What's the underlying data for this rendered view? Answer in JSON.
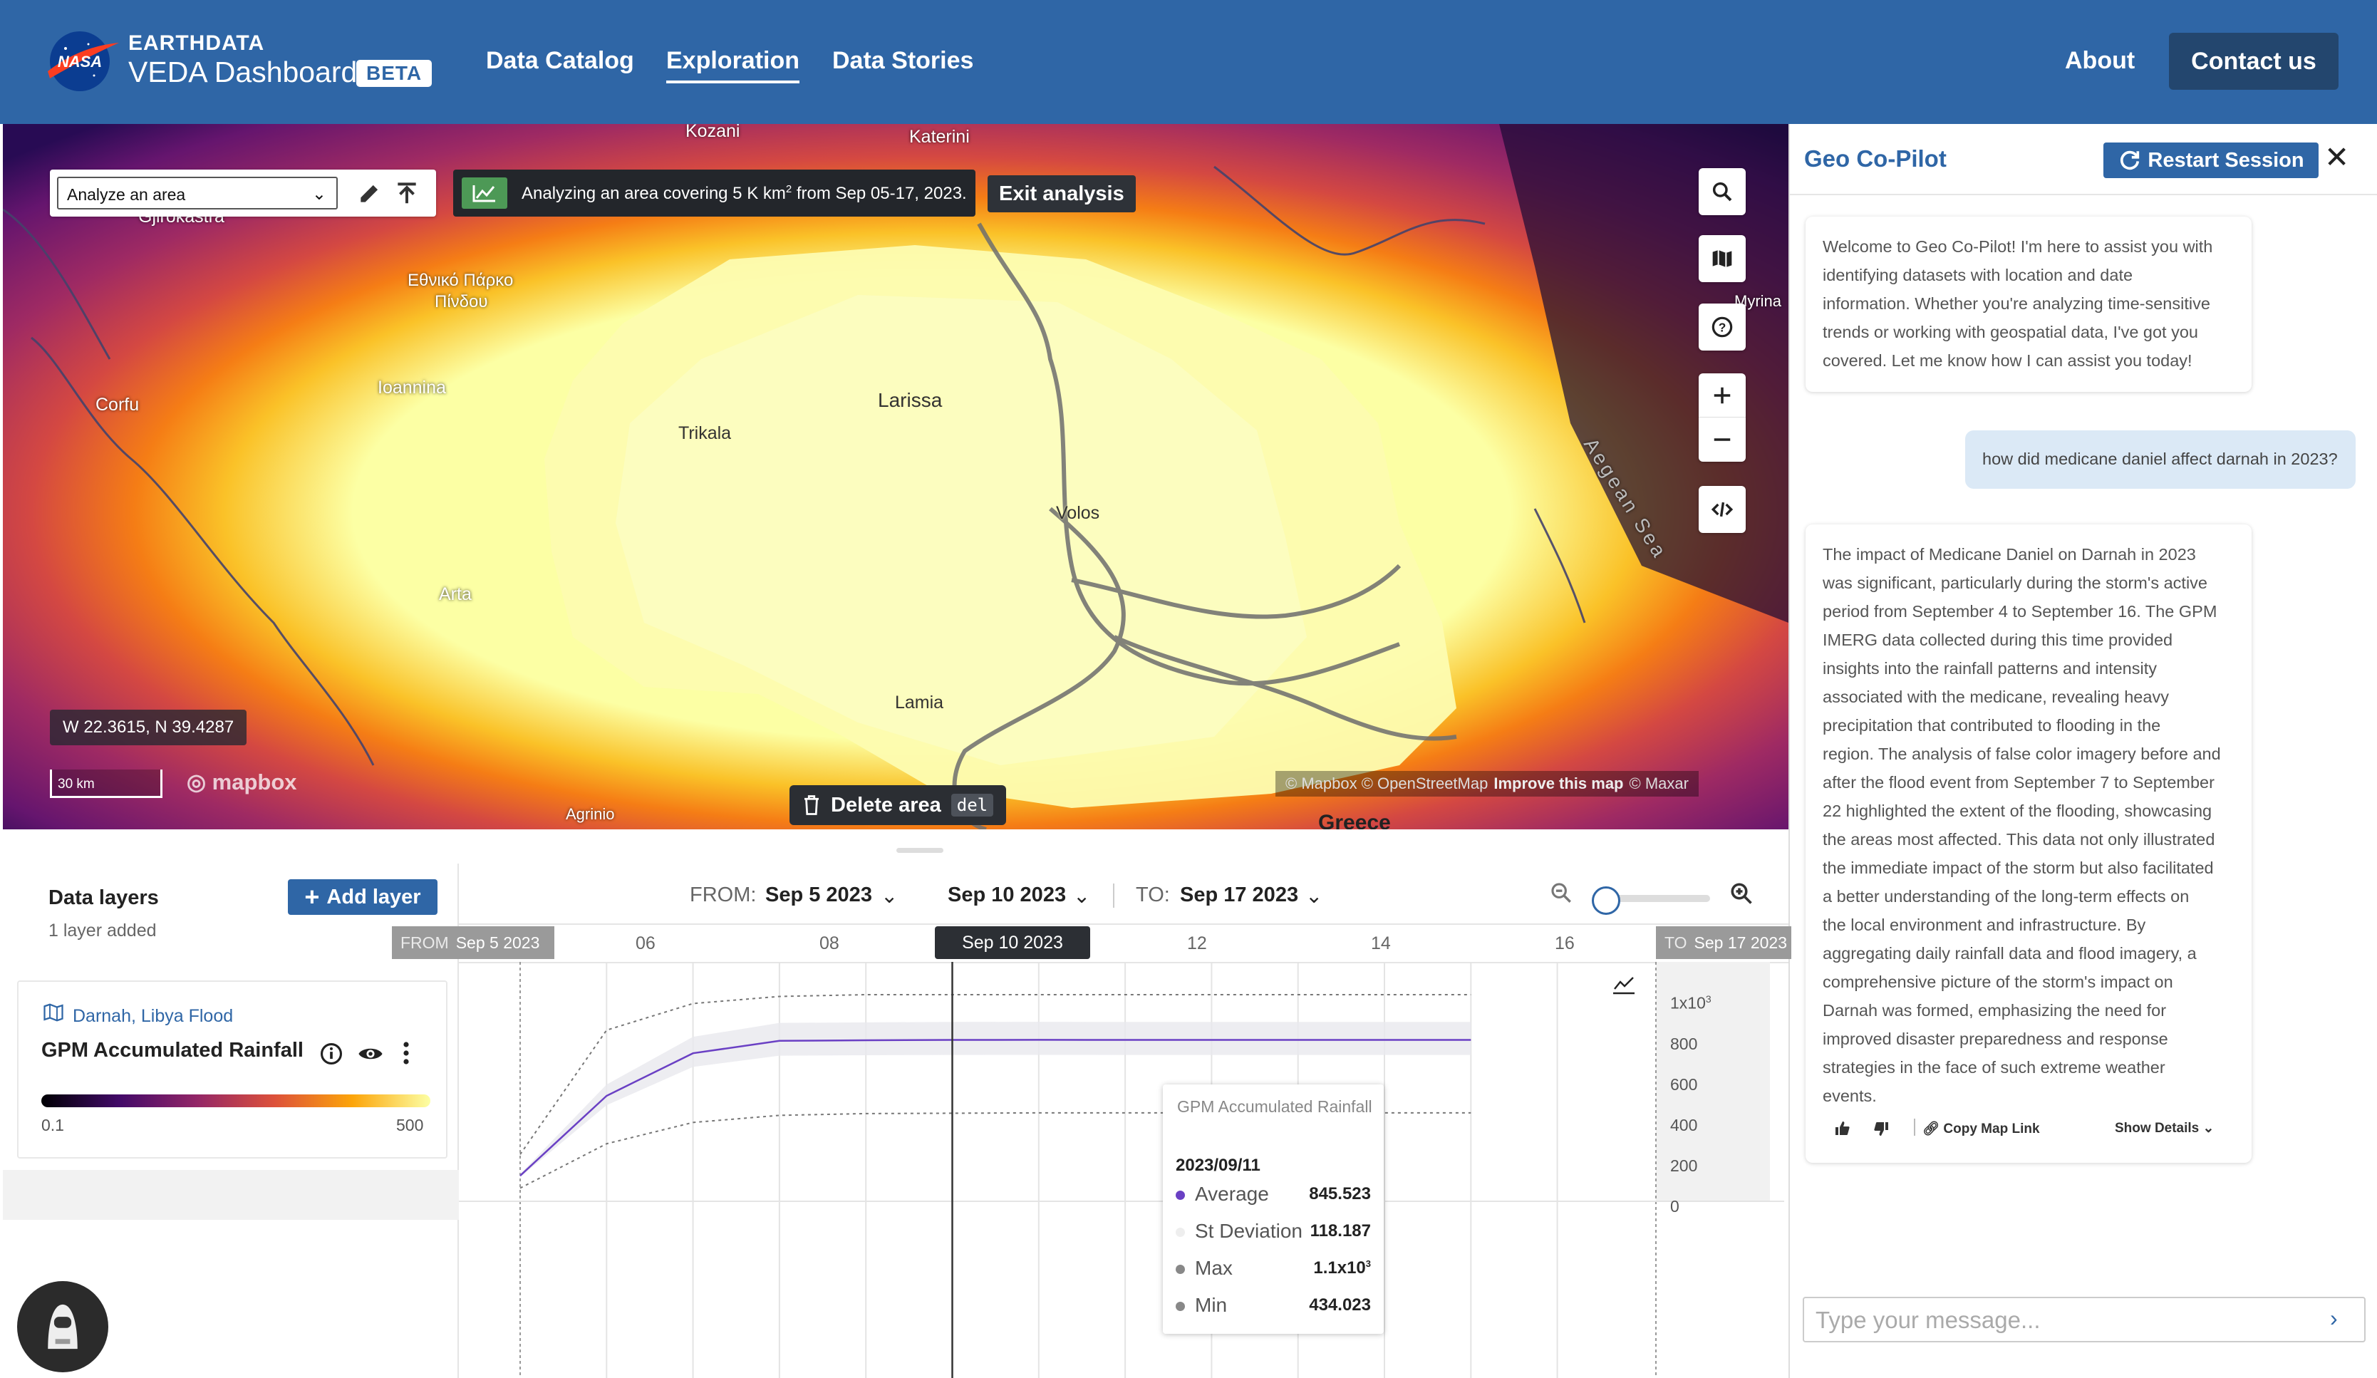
{
  "header": {
    "brand_top": "EARTHDATA",
    "brand_main": "VEDA Dashboard",
    "badge": "BETA",
    "nav": [
      "Data Catalog",
      "Exploration",
      "Data Stories"
    ],
    "active_nav": "Exploration",
    "about": "About",
    "contact": "Contact us"
  },
  "map": {
    "labels": [
      "Kozani",
      "Katerini",
      "Gjirokastra",
      "Εθνικό Πάρκο",
      "Πίνδου",
      "Ioannina",
      "Corfu",
      "Larissa",
      "Trikala",
      "Volos",
      "Arta",
      "Lamia",
      "Agrinio",
      "Aegean Sea",
      "Myrina",
      "Greece"
    ],
    "analyze_select": "Analyze an area",
    "analysis_text_pre": "Analyzing an area covering 5 K km",
    "analysis_sup": "2",
    "analysis_text_post": " from Sep 05-17, 2023.",
    "exit_button": "Exit analysis",
    "coords": "W 22.3615, N 39.4287",
    "scale": "30 km",
    "mapbox": "mapbox",
    "attribution": "© Mapbox © OpenStreetMap",
    "improve": "Improve this map",
    "maxar": "© Maxar",
    "delete_area": "Delete area",
    "delete_key": "del",
    "controls": [
      "search-icon",
      "map-icon",
      "help-icon",
      "plus-icon",
      "minus-icon",
      "code-icon"
    ]
  },
  "copilot": {
    "title": "Geo Co-Pilot",
    "restart": "Restart Session",
    "welcome": [
      "Welcome to Geo Co-Pilot! I'm here to assist you with",
      "identifying datasets with location and date",
      "information. Whether you're analyzing time-sensitive",
      "trends or working with geospatial data, I've got you",
      "covered. Let me know how I can assist you today!"
    ],
    "user_question": "how did medicane daniel affect darnah in 2023?",
    "answer": [
      "The impact of Medicane Daniel on Darnah in 2023",
      "was significant, particularly during the storm's active",
      "period from September 4 to September 16. The GPM",
      "IMERG data collected during this time provided",
      "insights into the rainfall patterns and intensity",
      "associated with the medicane, revealing heavy",
      "precipitation that contributed to flooding in the",
      "region. The analysis of false color imagery before and",
      "after the flood event from September 7 to September",
      "22 highlighted the extent of the flooding, showcasing",
      "the areas most affected. This data not only illustrated",
      "the immediate impact of the storm but also facilitated",
      "a better understanding of the long-term effects on",
      "the local environment and infrastructure. By",
      "aggregating daily rainfall data and flood imagery, a",
      "comprehensive picture of the storm's impact on",
      "Darnah was formed, emphasizing the need for",
      "improved disaster preparedness and response",
      "strategies in the face of such extreme weather",
      "events."
    ],
    "copy_link": "Copy Map Link",
    "show_details": "Show Details",
    "input_placeholder": "Type your message..."
  },
  "layers": {
    "title": "Data layers",
    "count": "1 layer added",
    "add_button": "Add layer",
    "card": {
      "dataset": "Darnah, Libya Flood",
      "name": "GPM Accumulated Rainfall",
      "legend_min": "0.1",
      "legend_max": "500"
    }
  },
  "dates": {
    "from_label": "FROM:",
    "from_value": "Sep 5 2023",
    "selected": "Sep 10 2023",
    "to_label": "TO:",
    "to_value": "Sep 17 2023",
    "flag_from_label": "FROM",
    "flag_to_label": "TO",
    "ticks": [
      "06",
      "08",
      "12",
      "14",
      "16"
    ]
  },
  "tooltip": {
    "title": "GPM Accumulated Rainfall",
    "date": "2023/09/11",
    "rows": [
      {
        "label": "Average",
        "value": "845.523",
        "color": "#6a40c4"
      },
      {
        "label": "St Deviation",
        "value": "118.187",
        "color": "#f0f0f0"
      },
      {
        "label": "Max",
        "value": "1.1x10",
        "sup": "3",
        "color": "#888888"
      },
      {
        "label": "Min",
        "value": "434.023",
        "color": "#888888"
      }
    ]
  },
  "chart_data": {
    "type": "line",
    "title": "GPM Accumulated Rainfall",
    "x": [
      "2023-09-05",
      "2023-09-06",
      "2023-09-07",
      "2023-09-08",
      "2023-09-09",
      "2023-09-10",
      "2023-09-11",
      "2023-09-12",
      "2023-09-13",
      "2023-09-14",
      "2023-09-15",
      "2023-09-16"
    ],
    "series": [
      {
        "name": "Average",
        "values": [
          80,
          530,
          770,
          840,
          843,
          845,
          845.523,
          845,
          845,
          845,
          845,
          845
        ]
      },
      {
        "name": "Max",
        "values": [
          200,
          900,
          1050,
          1090,
          1100,
          1100,
          1100,
          1100,
          1100,
          1100,
          1100,
          1100
        ]
      },
      {
        "name": "Min",
        "values": [
          10,
          260,
          380,
          420,
          430,
          432,
          434.023,
          434,
          434,
          434,
          434,
          434
        ]
      }
    ],
    "yticks": [
      "0",
      "200",
      "400",
      "600",
      "800",
      "1x10"
    ],
    "ytick_top_sup": "3",
    "ylim": [
      0,
      1100
    ]
  }
}
